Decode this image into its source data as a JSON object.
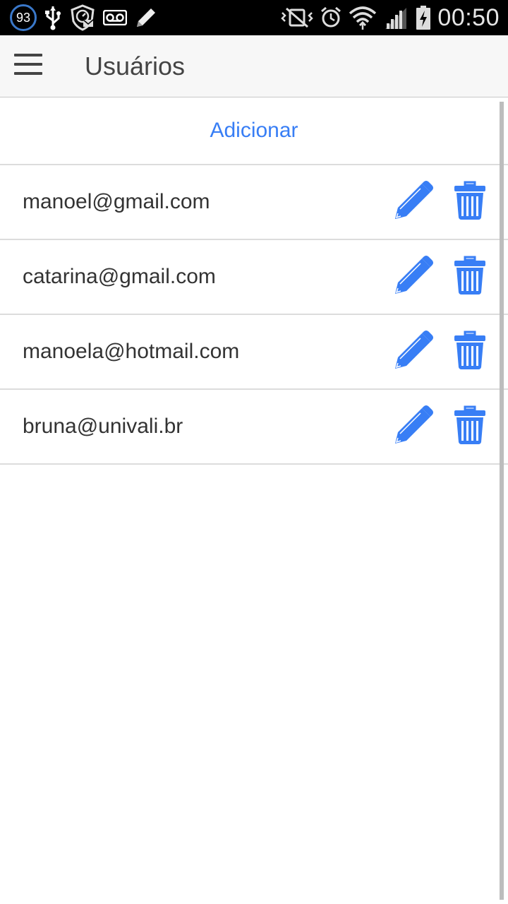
{
  "status_bar": {
    "notification_count": "93",
    "time": "00:50",
    "left_icons": [
      "notification-count-icon",
      "usb-icon",
      "shield-mail-icon",
      "voicemail-icon",
      "pencil-notification-icon"
    ],
    "right_icons": [
      "vibrate-off-icon",
      "alarm-icon",
      "wifi-icon",
      "signal-icon",
      "battery-charging-icon"
    ]
  },
  "app_bar": {
    "menu_icon": "hamburger-menu-icon",
    "title": "Usuários"
  },
  "list": {
    "add_label": "Adicionar",
    "accent_color": "#387ef5",
    "users": [
      {
        "email": "manoel@gmail.com"
      },
      {
        "email": "catarina@gmail.com"
      },
      {
        "email": "manoela@hotmail.com"
      },
      {
        "email": "bruna@univali.br"
      }
    ],
    "row_actions": [
      "edit-icon",
      "trash-icon"
    ]
  }
}
